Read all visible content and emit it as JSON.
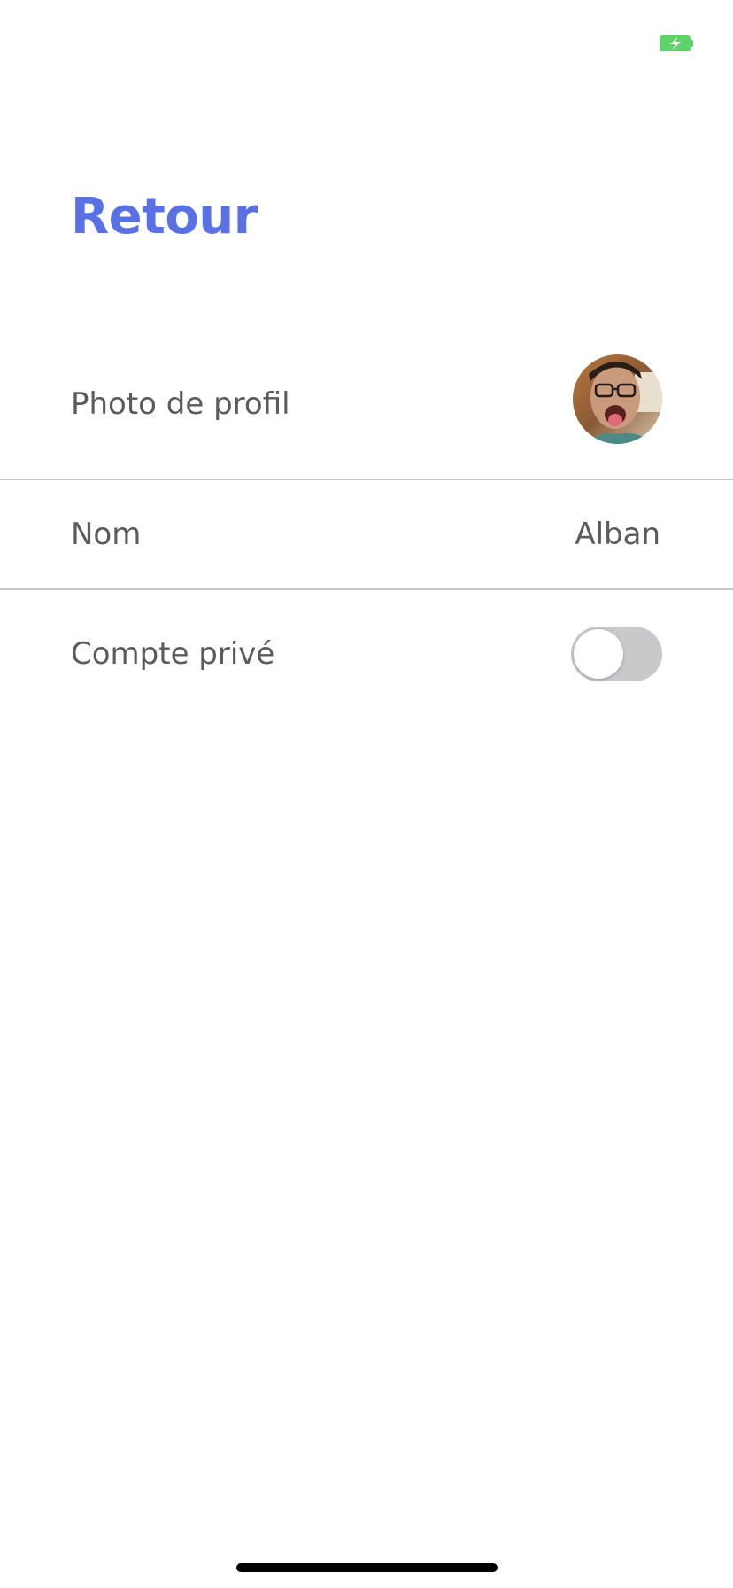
{
  "status_bar": {
    "battery_icon": "battery-charging-icon",
    "battery_color": "#5fd36a"
  },
  "header": {
    "back_label": "Retour",
    "accent_color": "#5a71e6"
  },
  "settings": {
    "profile_photo": {
      "label": "Photo de profil",
      "avatar": "avatar-photo"
    },
    "name": {
      "label": "Nom",
      "value": "Alban"
    },
    "private_account": {
      "label": "Compte privé",
      "toggle_on": false
    }
  }
}
